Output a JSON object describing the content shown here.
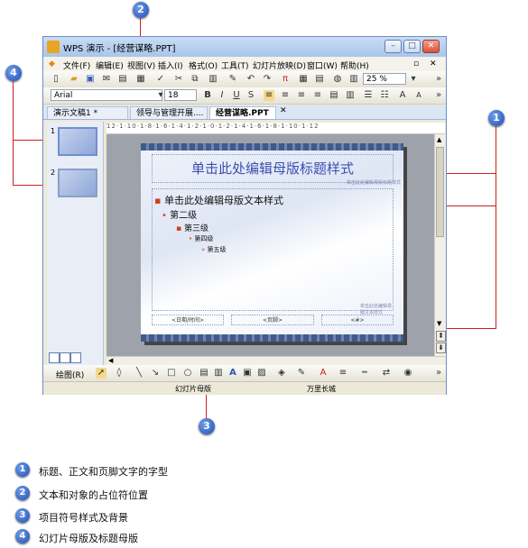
{
  "window": {
    "title": "WPS 演示 - [经营谋略.PPT]",
    "menu": [
      "文件(F)",
      "编辑(E)",
      "视图(V)",
      "插入(I)",
      "格式(O)",
      "工具(T)",
      "幻灯片放映(D)",
      "窗口(W)",
      "帮助(H)"
    ],
    "font_name": "Arial",
    "font_size": "18",
    "zoom": "25 %",
    "tabs": [
      "演示文稿1 *",
      "领导与管理开展....",
      "经营谋略.PPT"
    ],
    "status_left": "幻灯片母版",
    "status_right": "万里长城",
    "drawing_label": "绘图(R)"
  },
  "slide": {
    "title": "单击此处编辑母版标题样式",
    "title_note": "单击此处编辑母版标题样式",
    "body_title": "单击此处编辑母版文本样式",
    "level2": "第二级",
    "level3": "第三级",
    "level4": "第四级",
    "level5": "第五级",
    "foot_left": "<日期/时间>",
    "foot_mid": "<页脚>",
    "foot_right": "<#>",
    "body_note": "单击此处编辑母版文本样式"
  },
  "thumbnails": [
    "1",
    "2"
  ],
  "ruler_text": "12·1·10·1·8·1·6·1·4·1·2·1·0·1·2·1·4·1·6·1·8·1·10·1·12",
  "callouts": [
    "1",
    "2",
    "3",
    "4"
  ],
  "legend": [
    {
      "num": "1",
      "text": "标题、正文和页脚文字的字型"
    },
    {
      "num": "2",
      "text": "文本和对象的占位符位置"
    },
    {
      "num": "3",
      "text": "项目符号样式及背景"
    },
    {
      "num": "4",
      "text": "幻灯片母版及标题母版"
    }
  ]
}
